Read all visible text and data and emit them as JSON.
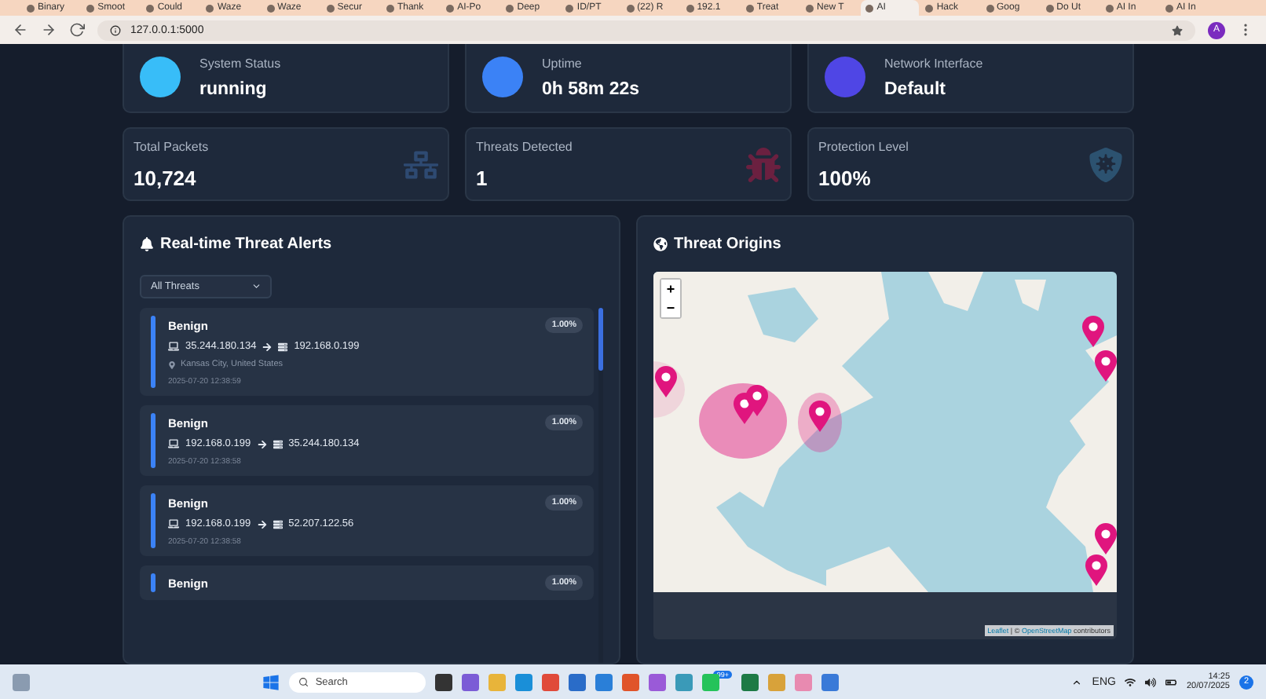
{
  "browser": {
    "tabs": [
      {
        "title": "Binary",
        "selected": false
      },
      {
        "title": "Smoot",
        "selected": false
      },
      {
        "title": "Could",
        "selected": false
      },
      {
        "title": "Waze",
        "selected": false
      },
      {
        "title": "Waze",
        "selected": false
      },
      {
        "title": "Secur",
        "selected": false
      },
      {
        "title": "Thank",
        "selected": false
      },
      {
        "title": "AI-Po",
        "selected": false
      },
      {
        "title": "Deep",
        "selected": false
      },
      {
        "title": "ID/PT",
        "selected": false
      },
      {
        "title": "(22) R",
        "selected": false
      },
      {
        "title": "192.1",
        "selected": false
      },
      {
        "title": "Treat",
        "selected": false
      },
      {
        "title": "New T",
        "selected": false
      },
      {
        "title": "AI",
        "selected": true
      },
      {
        "title": "Hack",
        "selected": false
      },
      {
        "title": "Goog",
        "selected": false
      },
      {
        "title": "Do Ut",
        "selected": false
      },
      {
        "title": "AI In",
        "selected": false
      },
      {
        "title": "AI In",
        "selected": false
      }
    ],
    "url": "127.0.0.1:5000",
    "profile": "A"
  },
  "status_cards": [
    {
      "label": "System Status",
      "value": "running",
      "color": "#38bdf8"
    },
    {
      "label": "Uptime",
      "value": "0h 58m 22s",
      "color": "#3b82f6"
    },
    {
      "label": "Network Interface",
      "value": "Default",
      "color": "#4f46e5"
    }
  ],
  "stat_cards": [
    {
      "label": "Total Packets",
      "value": "10,724",
      "kind": "network"
    },
    {
      "label": "Threats Detected",
      "value": "1",
      "kind": "bug"
    },
    {
      "label": "Protection Level",
      "value": "100%",
      "kind": "shield"
    }
  ],
  "alerts_panel": {
    "title": "Real-time Threat Alerts",
    "filter": "All Threats",
    "alerts": [
      {
        "name": "Benign",
        "confidence": "1.00%",
        "source": "35.244.180.134",
        "destination": "192.168.0.199",
        "location": "Kansas City, United States",
        "time": "2025-07-20 12:38:59"
      },
      {
        "name": "Benign",
        "confidence": "1.00%",
        "source": "192.168.0.199",
        "destination": "35.244.180.134",
        "time": "2025-07-20 12:38:58"
      },
      {
        "name": "Benign",
        "confidence": "1.00%",
        "source": "192.168.0.199",
        "destination": "52.207.122.56",
        "time": "2025-07-20 12:38:58"
      },
      {
        "name": "Benign",
        "confidence": "1.00%"
      }
    ]
  },
  "map_panel": {
    "title": "Threat Origins",
    "zoom_in": "+",
    "zoom_out": "−",
    "attribution": {
      "library": "Leaflet",
      "separator": "|  ©",
      "source": "OpenStreetMap",
      "suffix": "contributors"
    }
  },
  "taskbar": {
    "search": "Search",
    "badge": "99+",
    "language": "ENG",
    "time": "14:25",
    "date": "20/07/2025",
    "notifications": "2"
  }
}
